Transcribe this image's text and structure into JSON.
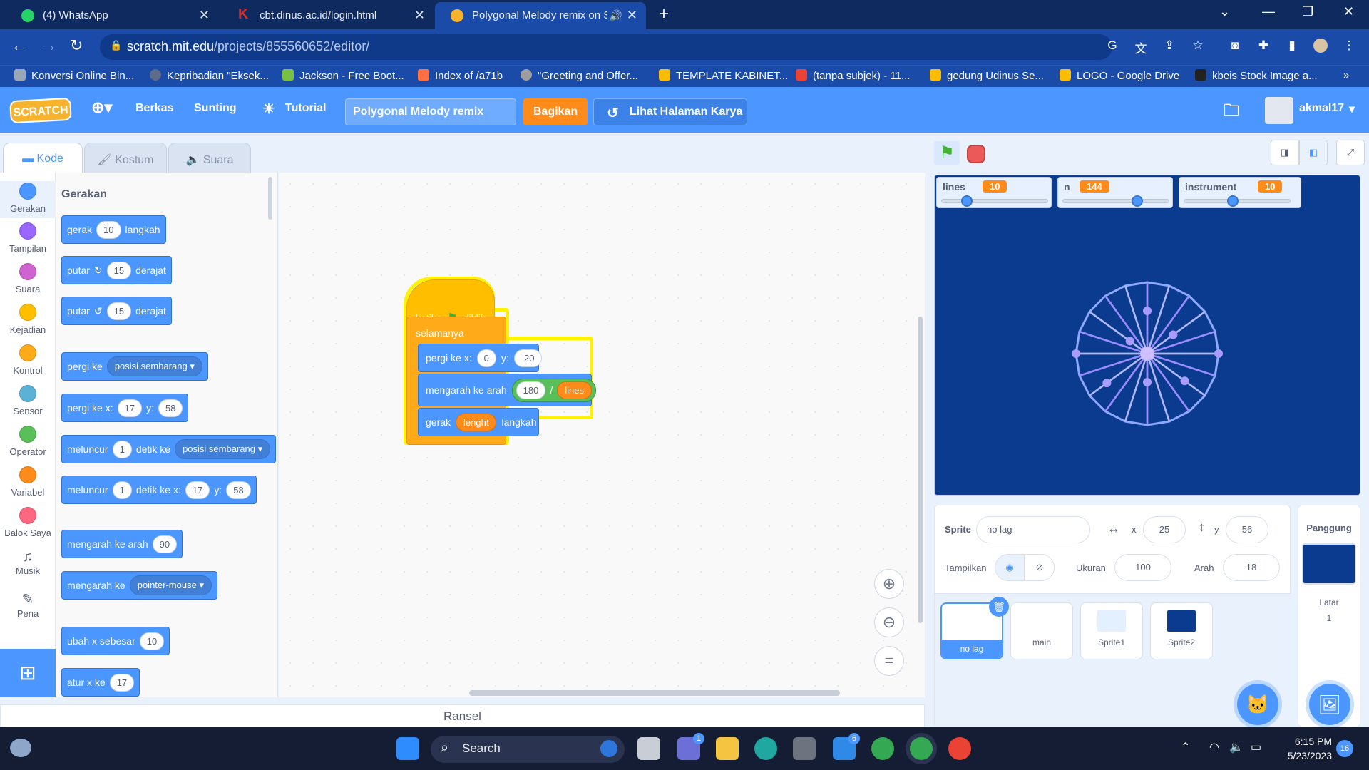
{
  "browser": {
    "tabs": [
      {
        "title": "(4) WhatsApp",
        "fav_color": "#25d366"
      },
      {
        "title": "cbt.dinus.ac.id/login.html",
        "fav_color": "#d32f2f",
        "fav_letter": "K"
      },
      {
        "title": "Polygonal Melody remix on S",
        "fav_color": "#f7b32b"
      }
    ],
    "new_tab": "+",
    "url_host": "scratch.mit.edu",
    "url_path": "/projects/855560652/editor/",
    "bookmarks": [
      {
        "label": "Konversi Online Bin...",
        "color": "#9aa7b8"
      },
      {
        "label": "Kepribadian \"Eksek...",
        "color": "#5d6c8a"
      },
      {
        "label": "Jackson - Free Boot...",
        "color": "#7ac143"
      },
      {
        "label": "Index of /a71b",
        "color": "#ff7043"
      },
      {
        "label": "\"Greeting and Offer...",
        "color": "#9e9e9e"
      },
      {
        "label": "TEMPLATE KABINET...",
        "color": "#fbbc04"
      },
      {
        "label": "(tanpa subjek) - 11...",
        "color": "#ea4335"
      },
      {
        "label": "gedung Udinus Se...",
        "color": "#fbbc04"
      },
      {
        "label": "LOGO - Google Drive",
        "color": "#fbbc04"
      },
      {
        "label": "kbeis Stock Image a...",
        "color": "#222222"
      }
    ],
    "more": "»"
  },
  "menu": {
    "logo": "SCRATCH",
    "file": "Berkas",
    "edit": "Sunting",
    "tutorial": "Tutorial",
    "project_title": "Polygonal Melody remix",
    "share": "Bagikan",
    "see_project": "Lihat Halaman Karya",
    "username": "akmal17"
  },
  "editor_tabs": [
    "Kode",
    "Kostum",
    "Suara"
  ],
  "categories": [
    {
      "label": "Gerakan",
      "color": "#4c97ff"
    },
    {
      "label": "Tampilan",
      "color": "#9966ff"
    },
    {
      "label": "Suara",
      "color": "#cf63cf"
    },
    {
      "label": "Kejadian",
      "color": "#ffbf00"
    },
    {
      "label": "Kontrol",
      "color": "#ffab19"
    },
    {
      "label": "Sensor",
      "color": "#5cb1d6"
    },
    {
      "label": "Operator",
      "color": "#59c059"
    },
    {
      "label": "Variabel",
      "color": "#ff8c1a"
    },
    {
      "label": "Balok Saya",
      "color": "#ff6680"
    },
    {
      "label": "Musik",
      "icon": "music-icon"
    },
    {
      "label": "Pena",
      "icon": "pen-icon"
    }
  ],
  "palette": {
    "heading": "Gerakan",
    "b1": {
      "a": "gerak",
      "v": "10",
      "b": "langkah"
    },
    "b2": {
      "a": "putar",
      "v": "15",
      "b": "derajat"
    },
    "b3": {
      "a": "putar",
      "v": "15",
      "b": "derajat"
    },
    "b4": {
      "a": "pergi ke",
      "d": "posisi sembarang"
    },
    "b5": {
      "a": "pergi ke x:",
      "v": "17",
      "b": "y:",
      "v2": "58"
    },
    "b6": {
      "a": "meluncur",
      "v": "1",
      "b": "detik ke",
      "d": "posisi sembarang"
    },
    "b7": {
      "a": "meluncur",
      "v": "1",
      "b": "detik ke x:",
      "v2": "17",
      "c": "y:",
      "v3": "58"
    },
    "b8": {
      "a": "mengarah ke arah",
      "v": "90"
    },
    "b9": {
      "a": "mengarah ke",
      "d": "pointer-mouse"
    },
    "b10": {
      "a": "ubah x sebesar",
      "v": "10"
    },
    "b11": {
      "a": "atur x ke",
      "v": "17"
    }
  },
  "script": {
    "hat": {
      "a": "ketika",
      "b": "diklik"
    },
    "forever": "selamanya",
    "goto": {
      "a": "pergi ke x:",
      "x": "0",
      "b": "y:",
      "y": "-20"
    },
    "point": {
      "a": "mengarah ke arah",
      "v": "180",
      "op": "/",
      "var": "lines"
    },
    "move": {
      "a": "gerak",
      "var": "lenght",
      "b": "langkah"
    }
  },
  "backpack": "Ransel",
  "monitors": [
    {
      "name": "lines",
      "value": "10",
      "fraction": 0.2
    },
    {
      "name": "n",
      "value": "144",
      "fraction": 0.72
    },
    {
      "name": "instrument",
      "value": "10",
      "fraction": 0.45
    }
  ],
  "sprite_info": {
    "sprite_label": "Sprite",
    "sprite_name": "no lag",
    "x_label": "x",
    "x": "25",
    "y_label": "y",
    "y": "56",
    "show_label": "Tampilkan",
    "size_label": "Ukuran",
    "size": "100",
    "dir_label": "Arah",
    "dir": "18"
  },
  "sprites": [
    {
      "name": "no lag",
      "selected": true,
      "thumb": "#ffffff"
    },
    {
      "name": "main",
      "selected": false,
      "thumb": "#ffffff"
    },
    {
      "name": "Sprite1",
      "selected": false,
      "thumb": "#e3f0ff"
    },
    {
      "name": "Sprite2",
      "selected": false,
      "thumb": "#0a3b8f"
    }
  ],
  "stage_pane": {
    "title": "Panggung",
    "backdrop_label": "Latar",
    "backdrop_count": "1"
  },
  "taskbar": {
    "search": "Search",
    "time": "6:15 PM",
    "date": "5/23/2023",
    "badge_teams": "1",
    "badge_mail": "6",
    "notif": "16"
  }
}
